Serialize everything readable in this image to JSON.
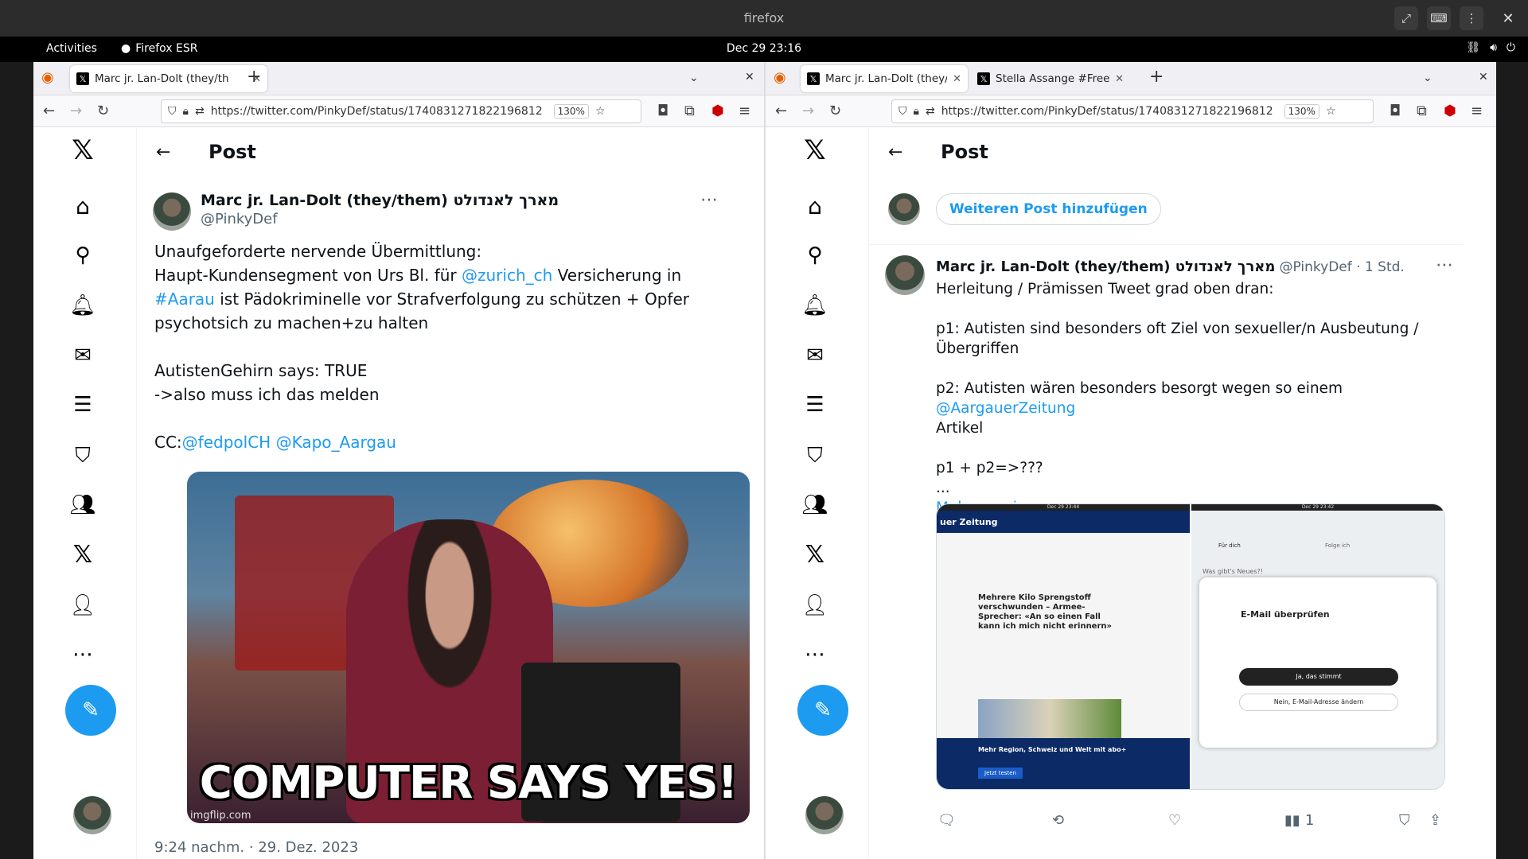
{
  "window": {
    "title": "firefox"
  },
  "topbar": {
    "activities": "Activities",
    "app": "Firefox ESR",
    "clock": "Dec 29  23:16"
  },
  "left": {
    "tabs": [
      {
        "label": "Marc jr. Lan-Dolt (they/th"
      }
    ],
    "url": "https://twitter.com/PinkyDef/status/1740831271822196812",
    "zoom": "130%",
    "header": "Post",
    "author": {
      "name": "Marc jr. Lan-Dolt (they/them) מארך לאנדולט",
      "handle": "@PinkyDef"
    },
    "tweet": {
      "line1": "Unaufgeforderte nervende Übermittlung:",
      "line2a": "Haupt-Kundensegment von Urs Bl. für ",
      "mention1": "@zurich_ch",
      "line2b": " Versicherung in",
      "hashtag": "#Aarau",
      "line3": " ist Pädokriminelle vor Strafverfolgung zu schützen + Opfer",
      "line4": "psychotsich zu machen+zu halten",
      "line5": "AutistenGehirn says: TRUE",
      "line6": "->also muss ich das melden",
      "cc": "CC:",
      "mention2": "@fedpolCH",
      "mention3": "@Kapo_Aargau"
    },
    "image": {
      "caption": "COMPUTER SAYS YES!",
      "watermark": "imgflip.com"
    },
    "timestamp": "9:24 nachm. · 29. Dez. 2023"
  },
  "right": {
    "tabs": [
      {
        "label": "Marc jr. Lan-Dolt (they/th"
      },
      {
        "label": "Stella Assange #FreeAssa"
      }
    ],
    "url": "https://twitter.com/PinkyDef/status/1740831271822196812",
    "zoom": "130%",
    "header": "Post",
    "add_post": "Weiteren Post hinzufügen",
    "author": {
      "name": "Marc jr. Lan-Dolt (they/them) מארך לאנדולט",
      "handle": "@PinkyDef · 1 Std."
    },
    "tweet": {
      "l1": "Herleitung / Prämissen Tweet grad oben dran:",
      "l2": "p1: Autisten sind besonders oft Ziel von sexueller/n Ausbeutung /",
      "l3": "Übergriffen",
      "l4": "p2: Autisten wären besonders besorgt wegen so einem ",
      "mention": "@AargauerZeitung",
      "l5": "Artikel",
      "l6": "p1 + p2=>???",
      "l7": "...",
      "more": "Mehr anzeigen"
    },
    "shot1": {
      "brand": "uer Zeitung",
      "headline": "Mehrere Kilo Sprengstoff verschwunden – Armee-Sprecher: «An so einen Fall kann ich mich nicht erinnern»",
      "banner": "Mehr Region, Schweiz und Welt mit abo+",
      "btn": "Jetzt testen",
      "time": "Dec 29  23:44"
    },
    "shot2": {
      "tab1": "Für dich",
      "tab2": "Folge ich",
      "compose": "Was gibt's Neues?!",
      "dlg_title": "E-Mail überprüfen",
      "dlg_btn1": "Ja, das stimmt",
      "dlg_btn2": "Nein, E-Mail-Adresse ändern",
      "time": "Dec 29  23:42"
    },
    "views": "1"
  },
  "colors": {
    "accent": "#1d9bf0",
    "text": "#0f1419",
    "muted": "#536471"
  }
}
